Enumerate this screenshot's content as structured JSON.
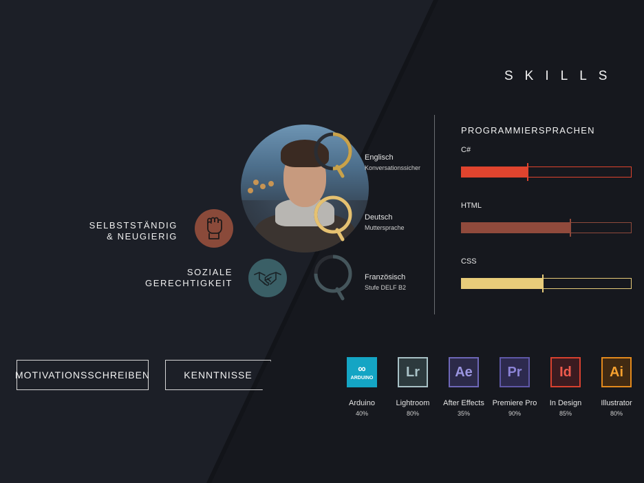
{
  "section_title": "SKILLS",
  "traits": [
    {
      "line1": "SELBSTSTÄNDIG",
      "line2": "& NEUGIERIG",
      "icon": "fist-icon",
      "color": "#8a4a3a"
    },
    {
      "line1": "SOZIALE",
      "line2": "GERECHTIGKEIT",
      "icon": "handshake-icon",
      "color": "#3a5f66"
    }
  ],
  "languages": [
    {
      "name": "Englisch",
      "level": "Konversationssicher",
      "color": "#c9a24a",
      "fraction": 0.5
    },
    {
      "name": "Deutsch",
      "level": "Muttersprache",
      "color": "#e5c171",
      "fraction": 1.0
    },
    {
      "name": "Französisch",
      "level": "Stufe DELF B2",
      "color": "#45565c",
      "fraction": 0.75
    }
  ],
  "programming": {
    "title": "PROGRAMMIERSPRACHEN",
    "bars": [
      {
        "label": "C#",
        "fraction": 0.39,
        "color": "#e0442e"
      },
      {
        "label": "HTML",
        "fraction": 0.64,
        "color": "#904a3c"
      },
      {
        "label": "CSS",
        "fraction": 0.48,
        "color": "#e8cc7a"
      }
    ]
  },
  "buttons": {
    "motivation": "MOTIVATIONSSCHREIBEN",
    "skills": "KENNTNISSE"
  },
  "apps": [
    {
      "abbr": "ARDUINO",
      "name": "Arduino",
      "pct": "40%",
      "bg": "#14a5c4",
      "fg": "#ffffff",
      "border": "#14a5c4"
    },
    {
      "abbr": "Lr",
      "name": "Lightroom",
      "pct": "80%",
      "bg": "#2d3a3e",
      "fg": "#a9c2c7",
      "border": "#a9c2c7"
    },
    {
      "abbr": "Ae",
      "name": "After Effects",
      "pct": "35%",
      "bg": "#2c2a49",
      "fg": "#9b95e0",
      "border": "#6e67b8"
    },
    {
      "abbr": "Pr",
      "name": "Premiere Pro",
      "pct": "90%",
      "bg": "#2d2a4e",
      "fg": "#8b83d6",
      "border": "#5f58a8"
    },
    {
      "abbr": "Id",
      "name": "In Design",
      "pct": "85%",
      "bg": "#3b1b20",
      "fg": "#ef5a4d",
      "border": "#d9412f"
    },
    {
      "abbr": "Ai",
      "name": "Illustrator",
      "pct": "80%",
      "bg": "#412a12",
      "fg": "#f7a12f",
      "border": "#e48a1c"
    }
  ]
}
